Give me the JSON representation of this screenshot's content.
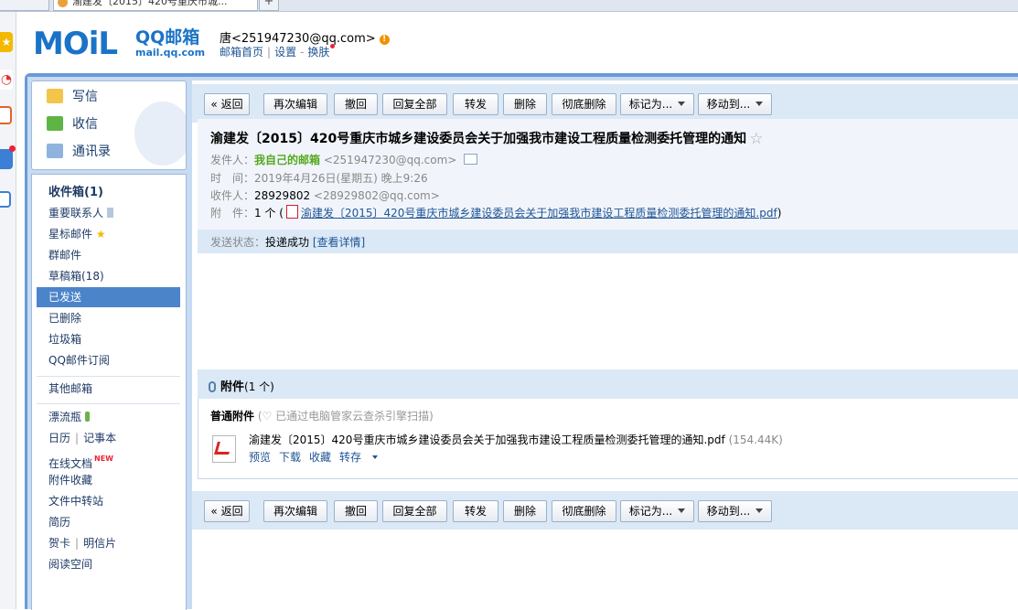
{
  "browser": {
    "tabs": [
      {
        "label": ""
      },
      {
        "label": "渝建发〔2015〕420号重庆市城..."
      }
    ],
    "new_tab": "+"
  },
  "header": {
    "logo_text": "MOiL",
    "logo_brand": "QQ邮箱",
    "logo_domain": "mail.qq.com",
    "user": "唐<251947230@qq.com>",
    "alert_icon": "!",
    "links": {
      "home": "邮箱首页",
      "settings": "设置",
      "skin": "换肤"
    },
    "sep": "|",
    "dash": "-"
  },
  "nav": {
    "compose": "写信",
    "inbox": "收信",
    "contacts": "通讯录"
  },
  "folders": {
    "inbox": "收件箱(1)",
    "important": "重要联系人",
    "starred": "星标邮件",
    "group": "群邮件",
    "drafts": "草稿箱(18)",
    "sent": "已发送",
    "deleted": "已删除",
    "spam": "垃圾箱",
    "subscriptions": "QQ邮件订阅",
    "other": "其他邮箱",
    "bottle": "漂流瓶",
    "calendar": "日历",
    "notes": "记事本",
    "docs": "在线文档",
    "new_badge": "NEW",
    "favorites": "附件收藏",
    "transfer": "文件中转站",
    "resume": "简历",
    "card": "贺卡",
    "postcard": "明信片",
    "reading": "阅读空间",
    "sep": "|"
  },
  "toolbar": {
    "back": "« 返回",
    "reedit": "再次编辑",
    "recall": "撤回",
    "reply_all": "回复全部",
    "forward": "转发",
    "delete": "删除",
    "delete_forever": "彻底删除",
    "mark_as": "标记为...",
    "move_to": "移动到..."
  },
  "mail": {
    "subject": "渝建发〔2015〕420号重庆市城乡建设委员会关于加强我市建设工程质量检测委托管理的通知",
    "star": "☆",
    "from_label": "发件人：",
    "from_name": "我自己的邮箱",
    "from_addr": "<251947230@qq.com>",
    "time_label": "时　间：",
    "time_value": "2019年4月26日(星期五) 晚上9:26",
    "to_label": "收件人：",
    "to_name": "28929802",
    "to_addr": "<28929802@qq.com>",
    "attach_label": "附　件：",
    "attach_count": "1 个 (",
    "attach_link": "渝建发〔2015〕420号重庆市城乡建设委员会关于加强我市建设工程质量检测委托管理的通知.pdf",
    "attach_close": ")",
    "status_label": "发送状态：",
    "status_value": "投递成功",
    "status_link": "[查看详情]"
  },
  "attachments": {
    "title": "附件",
    "count": "(1 个)",
    "group_label": "普通附件",
    "scan_note": "(♡ 已通过电脑管家云查杀引擎扫描)",
    "file_name": "渝建发〔2015〕420号重庆市城乡建设委员会关于加强我市建设工程质量检测委托管理的通知.pdf",
    "file_size": "(154.44K)",
    "actions": {
      "preview": "预览",
      "download": "下载",
      "collect": "收藏",
      "save_to": "转存"
    }
  },
  "colors": {
    "frame": "#6a9ad6",
    "selected": "#4c84c9",
    "link": "#1e5494",
    "toolbar_bg": "#dbe8f6"
  }
}
